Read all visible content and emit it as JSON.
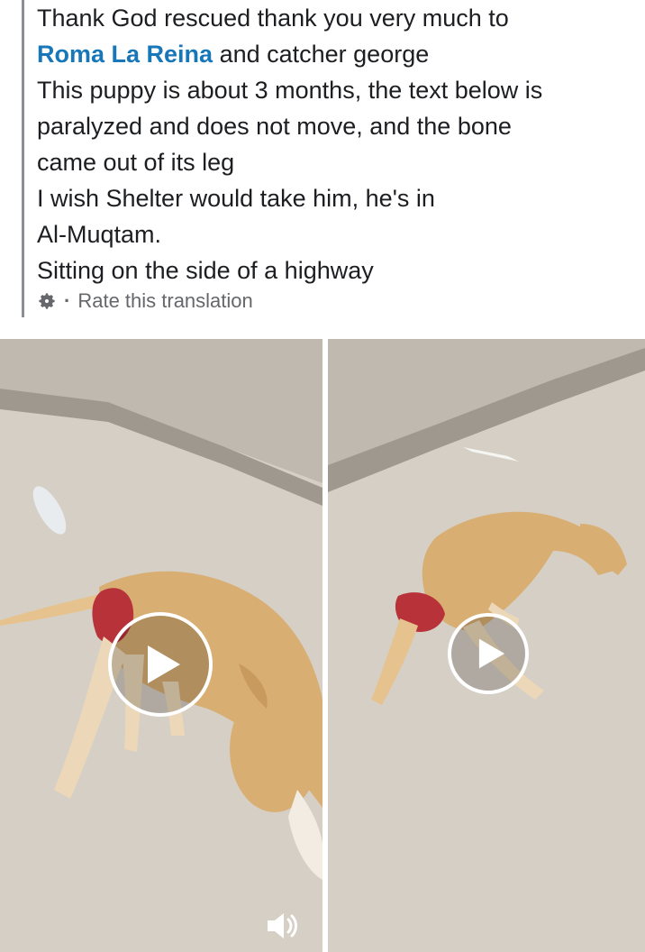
{
  "post": {
    "line1": "Thank God rescued thank you very much to",
    "mention": "Roma La Reina",
    "line2_rest": " and catcher george",
    "line3": "This puppy is about 3 months, the text below is",
    "line4": "paralyzed and does not move, and the bone",
    "line5": "came out of its leg",
    "line6": "I wish Shelter would take him, he's in",
    "line7": "Al-Muqtam.",
    "line8": "Sitting on the side of a highway"
  },
  "translation": {
    "separator": "·",
    "link_label": "Rate this translation",
    "icon": "gear-icon"
  },
  "media": {
    "videos": [
      {
        "icon": "play-icon"
      },
      {
        "icon": "play-icon"
      }
    ],
    "sound_icon": "volume-icon"
  },
  "colors": {
    "text": "#1c1e21",
    "mention": "#1877b8",
    "muted": "#65676b",
    "ground": "#d6cfc5",
    "dog": "#d8ae72",
    "wound": "#b8323a"
  }
}
